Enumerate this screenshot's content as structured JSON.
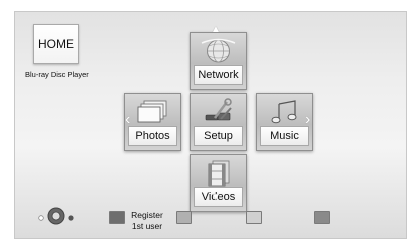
{
  "home": {
    "title": "HOME",
    "subtitle": "Blu-ray Disc Player"
  },
  "menu": {
    "network": "Network",
    "photos": "Photos",
    "setup": "Setup",
    "music": "Music",
    "videos": "Videos"
  },
  "footer": {
    "register_line1": "Register",
    "register_line2": "1st user",
    "colors": {
      "red": "#6e6e6e",
      "green": "#b0b0b0",
      "yellow": "#d0d0d0",
      "blue": "#8a8a8a"
    }
  },
  "icons": {
    "network": "globe-icon",
    "photos": "photo-stack-icon",
    "setup": "tools-icon",
    "music": "music-note-icon",
    "videos": "film-strip-icon",
    "remote": "remote-dpad-icon"
  }
}
